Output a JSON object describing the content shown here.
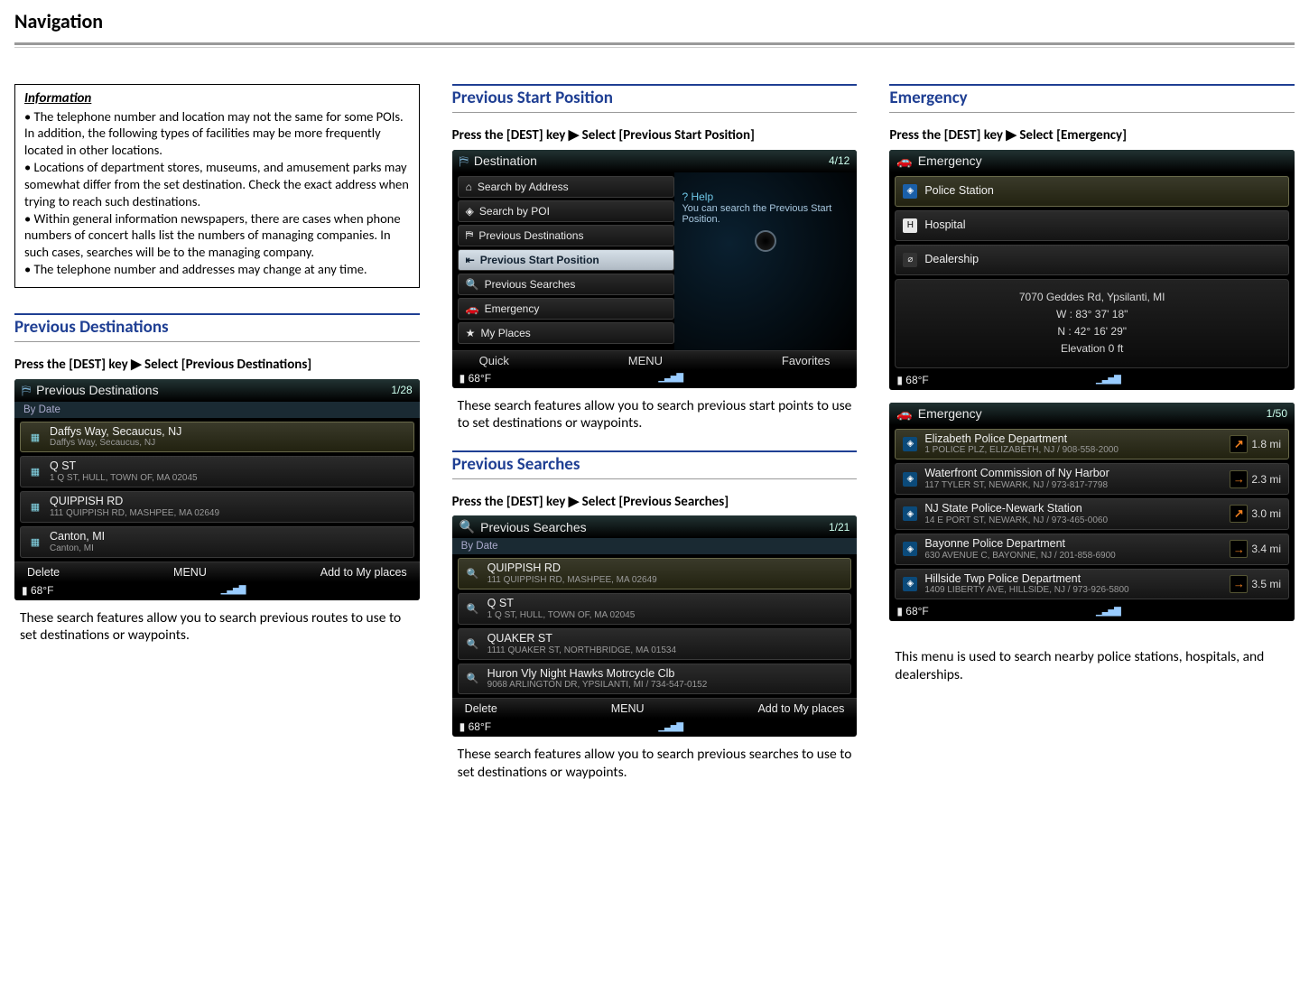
{
  "page": {
    "title": "Navigation"
  },
  "info": {
    "title": "Information",
    "b1": "• The telephone number and location may not the same for some POIs. In addition, the following types of facilities may be more frequently located in other locations.",
    "b2": "• Locations of department stores, museums, and amusement parks may somewhat differ from the set destination. Check the exact address when trying to reach such destinations.",
    "b3": "• Within general information newspapers, there are cases when phone numbers of concert halls list the numbers of managing companies. In such cases, searches will be to the managing company.",
    "b4": "• The telephone number and addresses may change at any time."
  },
  "prevdest": {
    "heading": "Previous Destinations",
    "instr": "Press the [DEST] key ▶ Select [Previous Destinations]",
    "title": "Previous Destinations",
    "count": "1/28",
    "sub": "By Date",
    "rows": [
      {
        "t1": "Daffys Way, Secaucus, NJ",
        "t2": "Daffys Way, Secaucus, NJ"
      },
      {
        "t1": "Q ST",
        "t2": "1 Q ST, HULL, TOWN OF, MA 02045"
      },
      {
        "t1": "QUIPPISH RD",
        "t2": "111 QUIPPISH RD, MASHPEE, MA 02649"
      },
      {
        "t1": "Canton, MI",
        "t2": "Canton, MI"
      }
    ],
    "bbar": {
      "l": "Delete",
      "m": "MENU",
      "r": "Add to My places"
    },
    "temp": "68°F",
    "body": "These search features allow you to search previous routes to use to set destinations or waypoints."
  },
  "prevstart": {
    "heading": "Previous Start Position",
    "instr": "Press the [DEST] key ▶ Select [Previous Start Position]",
    "title": "Destination",
    "count": "4/12",
    "menu": [
      "Search by Address",
      "Search by POI",
      "Previous Destinations",
      "Previous Start Position",
      "Previous Searches",
      "Emergency",
      "My Places"
    ],
    "help_t": "Help",
    "help": "You can search the Previous Start Position.",
    "tabs": {
      "l": "Quick",
      "m": "MENU",
      "r": "Favorites"
    },
    "temp": "68°F",
    "body": "These search features allow you to search previous start points to use to set destinations or waypoints."
  },
  "prevsearch": {
    "heading": "Previous Searches",
    "instr": "Press the [DEST] key ▶ Select [Previous Searches]",
    "title": "Previous Searches",
    "count": "1/21",
    "sub": "By Date",
    "rows": [
      {
        "t1": "QUIPPISH RD",
        "t2": "111 QUIPPISH RD, MASHPEE, MA 02649"
      },
      {
        "t1": "Q ST",
        "t2": "1 Q ST, HULL, TOWN OF, MA 02045"
      },
      {
        "t1": "QUAKER ST",
        "t2": "1111 QUAKER ST, NORTHBRIDGE, MA 01534"
      },
      {
        "t1": "Huron Vly Night Hawks Motrcycle Clb",
        "t2": "9068 ARLINGTON DR, YPSILANTI, MI / 734-547-0152"
      }
    ],
    "bbar": {
      "l": "Delete",
      "m": "MENU",
      "r": "Add to My places"
    },
    "temp": "68°F",
    "body": "These search features allow you to search previous searches to use to set destinations or waypoints."
  },
  "emergency": {
    "heading": "Emergency",
    "instr": "Press the [DEST] key ▶ Select [Emergency]",
    "title": "Emergency",
    "cats": [
      {
        "label": "Police Station",
        "badge": "b-blue",
        "glyph": "◈"
      },
      {
        "label": "Hospital",
        "badge": "b-white",
        "glyph": "H"
      },
      {
        "label": "Dealership",
        "badge": "b-hy",
        "glyph": "⌀"
      }
    ],
    "addr": {
      "l1": "7070 Geddes Rd, Ypsilanti, MI",
      "l2": "W : 83° 37' 18\"",
      "l3": "N : 42° 16' 29\"",
      "l4": "Elevation 0 ft"
    },
    "temp": "68°F",
    "list_count": "1/50",
    "list": [
      {
        "t1": "Elizabeth Police Department",
        "t2": "1 POLICE PLZ, ELIZABETH, NJ / 908-558-2000",
        "dist": "1.8 mi",
        "arr": "↗"
      },
      {
        "t1": "Waterfront Commission of Ny Harbor",
        "t2": "117 TYLER ST, NEWARK, NJ / 973-817-7798",
        "dist": "2.3 mi",
        "arr": "→"
      },
      {
        "t1": "NJ State Police-Newark Station",
        "t2": "14 E PORT ST, NEWARK, NJ / 973-465-0060",
        "dist": "3.0 mi",
        "arr": "↗"
      },
      {
        "t1": "Bayonne Police Department",
        "t2": "630 AVENUE C, BAYONNE, NJ / 201-858-6900",
        "dist": "3.4 mi",
        "arr": "→"
      },
      {
        "t1": "Hillside Twp Police Department",
        "t2": "1409 LIBERTY AVE, HILLSIDE, NJ / 973-926-5800",
        "dist": "3.5 mi",
        "arr": "→"
      }
    ],
    "temp2": "68°F",
    "body": "This menu is used to search nearby police stations, hospitals, and dealerships."
  },
  "icons": {
    "question": "?",
    "search": "🔍",
    "pin": "⌖",
    "car": "🚗"
  }
}
